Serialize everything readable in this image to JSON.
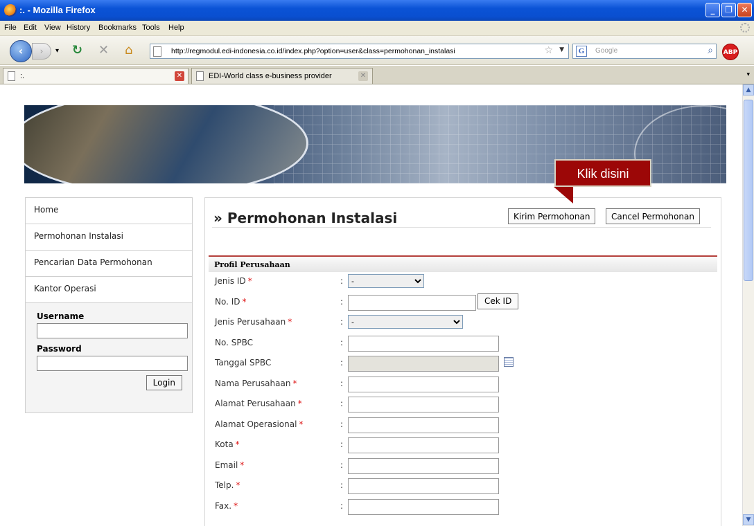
{
  "window": {
    "title": ":. - Mozilla Firefox"
  },
  "menu": [
    "File",
    "Edit",
    "View",
    "History",
    "Bookmarks",
    "Tools",
    "Help"
  ],
  "nav": {
    "url": "http://regmodul.edi-indonesia.co.id/index.php?option=user&class=permohonan_instalasi",
    "search_placeholder": "Google",
    "abp": "ABP"
  },
  "tabs": [
    {
      "label": ":."
    },
    {
      "label": "EDI-World class e-business provider"
    }
  ],
  "sidebar": {
    "items": [
      {
        "label": "Home"
      },
      {
        "label": "Permohonan Instalasi"
      },
      {
        "label": "Pencarian Data Permohonan"
      },
      {
        "label": "Kantor Operasi"
      }
    ],
    "username_label": "Username",
    "password_label": "Password",
    "login_label": "Login"
  },
  "main": {
    "title": "» Permohonan Instalasi",
    "submit_label": "Kirim Permohonan",
    "cancel_label": "Cancel Permohonan",
    "callout": "Klik disini",
    "section_title": "Profil Perusahaan",
    "cek_label": "Cek ID",
    "fields": [
      {
        "label": "Jenis ID",
        "required": "*",
        "type": "select",
        "value": "-"
      },
      {
        "label": "No. ID",
        "required": "*",
        "type": "text-cek",
        "value": ""
      },
      {
        "label": "Jenis Perusahaan",
        "required": "*",
        "type": "select-wide",
        "value": "-"
      },
      {
        "label": "No. SPBC",
        "required": "",
        "type": "text",
        "value": ""
      },
      {
        "label": "Tanggal SPBC",
        "required": "",
        "type": "date",
        "value": ""
      },
      {
        "label": "Nama Perusahaan",
        "required": "*",
        "type": "text",
        "value": ""
      },
      {
        "label": "Alamat Perusahaan",
        "required": "*",
        "type": "text",
        "value": ""
      },
      {
        "label": "Alamat Operasional",
        "required": "*",
        "type": "text",
        "value": ""
      },
      {
        "label": "Kota",
        "required": "*",
        "type": "text",
        "value": ""
      },
      {
        "label": "Email",
        "required": "*",
        "type": "text",
        "value": ""
      },
      {
        "label": "Telp.",
        "required": "*",
        "type": "text",
        "value": ""
      },
      {
        "label": "Fax.",
        "required": "*",
        "type": "text",
        "value": ""
      }
    ]
  }
}
